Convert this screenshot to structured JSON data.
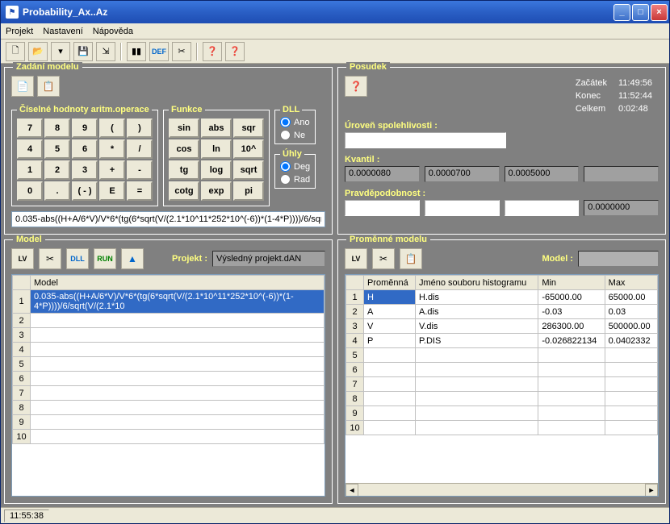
{
  "title": "Probability_Ax..Az",
  "menu": {
    "projekt": "Projekt",
    "nastaveni": "Nastavení",
    "napoveda": "Nápověda"
  },
  "panels": {
    "zadani": "Zadání modelu",
    "posudek": "Posudek",
    "model": "Model",
    "promenne": "Proměnné modelu"
  },
  "groups": {
    "ciselne": "Číselné hodnoty  aritm.operace",
    "funkce": "Funkce",
    "dll": "DLL",
    "uhly": "Úhly"
  },
  "keypad": [
    "7",
    "8",
    "9",
    "(",
    ")",
    "4",
    "5",
    "6",
    "*",
    "/",
    "1",
    "2",
    "3",
    "+",
    "-",
    "0",
    ".",
    "( - )",
    "E",
    "="
  ],
  "funcs": [
    "sin",
    "abs",
    "sqr",
    "cos",
    "ln",
    "10^",
    "tg",
    "log",
    "sqrt",
    "cotg",
    "exp",
    "pi"
  ],
  "radio": {
    "ano": "Ano",
    "ne": "Ne",
    "deg": "Deg",
    "rad": "Rad"
  },
  "formula": "0.035-abs((H+A/6*V)/V*6*(tg(6*sqrt(V/(2.1*10^11*252*10^(-6))*(1-4*P))))/6/sqr",
  "projekt_label": "Projekt :",
  "projekt_value": "Výsledný projekt.dAN",
  "model_label2": "Model :",
  "model_col": "Model",
  "model_row": "0.035-abs((H+A/6*V)/V*6*(tg(6*sqrt(V/(2.1*10^11*252*10^(-6))*(1-4*P))))/6/sqrt(V/(2.1*10",
  "posudek": {
    "uroven": "Úroveň spolehlivosti :",
    "kvantil": "Kvantil :",
    "pravd": "Pravděpodobnost :",
    "q": [
      "0.0000080",
      "0.0000700",
      "0.0005000",
      ""
    ],
    "p": [
      "",
      "",
      "",
      "0.0000000"
    ],
    "info": {
      "zacatek_l": "Začátek",
      "zacatek_v": "11:49:56",
      "konec_l": "Konec",
      "konec_v": "11:52:44",
      "celkem_l": "Celkem",
      "celkem_v": "0:02:48"
    }
  },
  "vars": {
    "headers": [
      "Proměnná",
      "Jméno souboru histogramu",
      "Min",
      "Max"
    ],
    "rows": [
      [
        "H",
        "H.dis",
        "-65000.00",
        "65000.00"
      ],
      [
        "A",
        "A.dis",
        "-0.03",
        "0.03"
      ],
      [
        "V",
        "V.dis",
        "286300.00",
        "500000.00"
      ],
      [
        "P",
        "P.DIS",
        "-0.026822134",
        "0.0402332"
      ]
    ]
  },
  "statusbar_time": "11:55:38",
  "tool_labels": {
    "def": "DEF",
    "dll": "DLL",
    "run": "RUN"
  }
}
